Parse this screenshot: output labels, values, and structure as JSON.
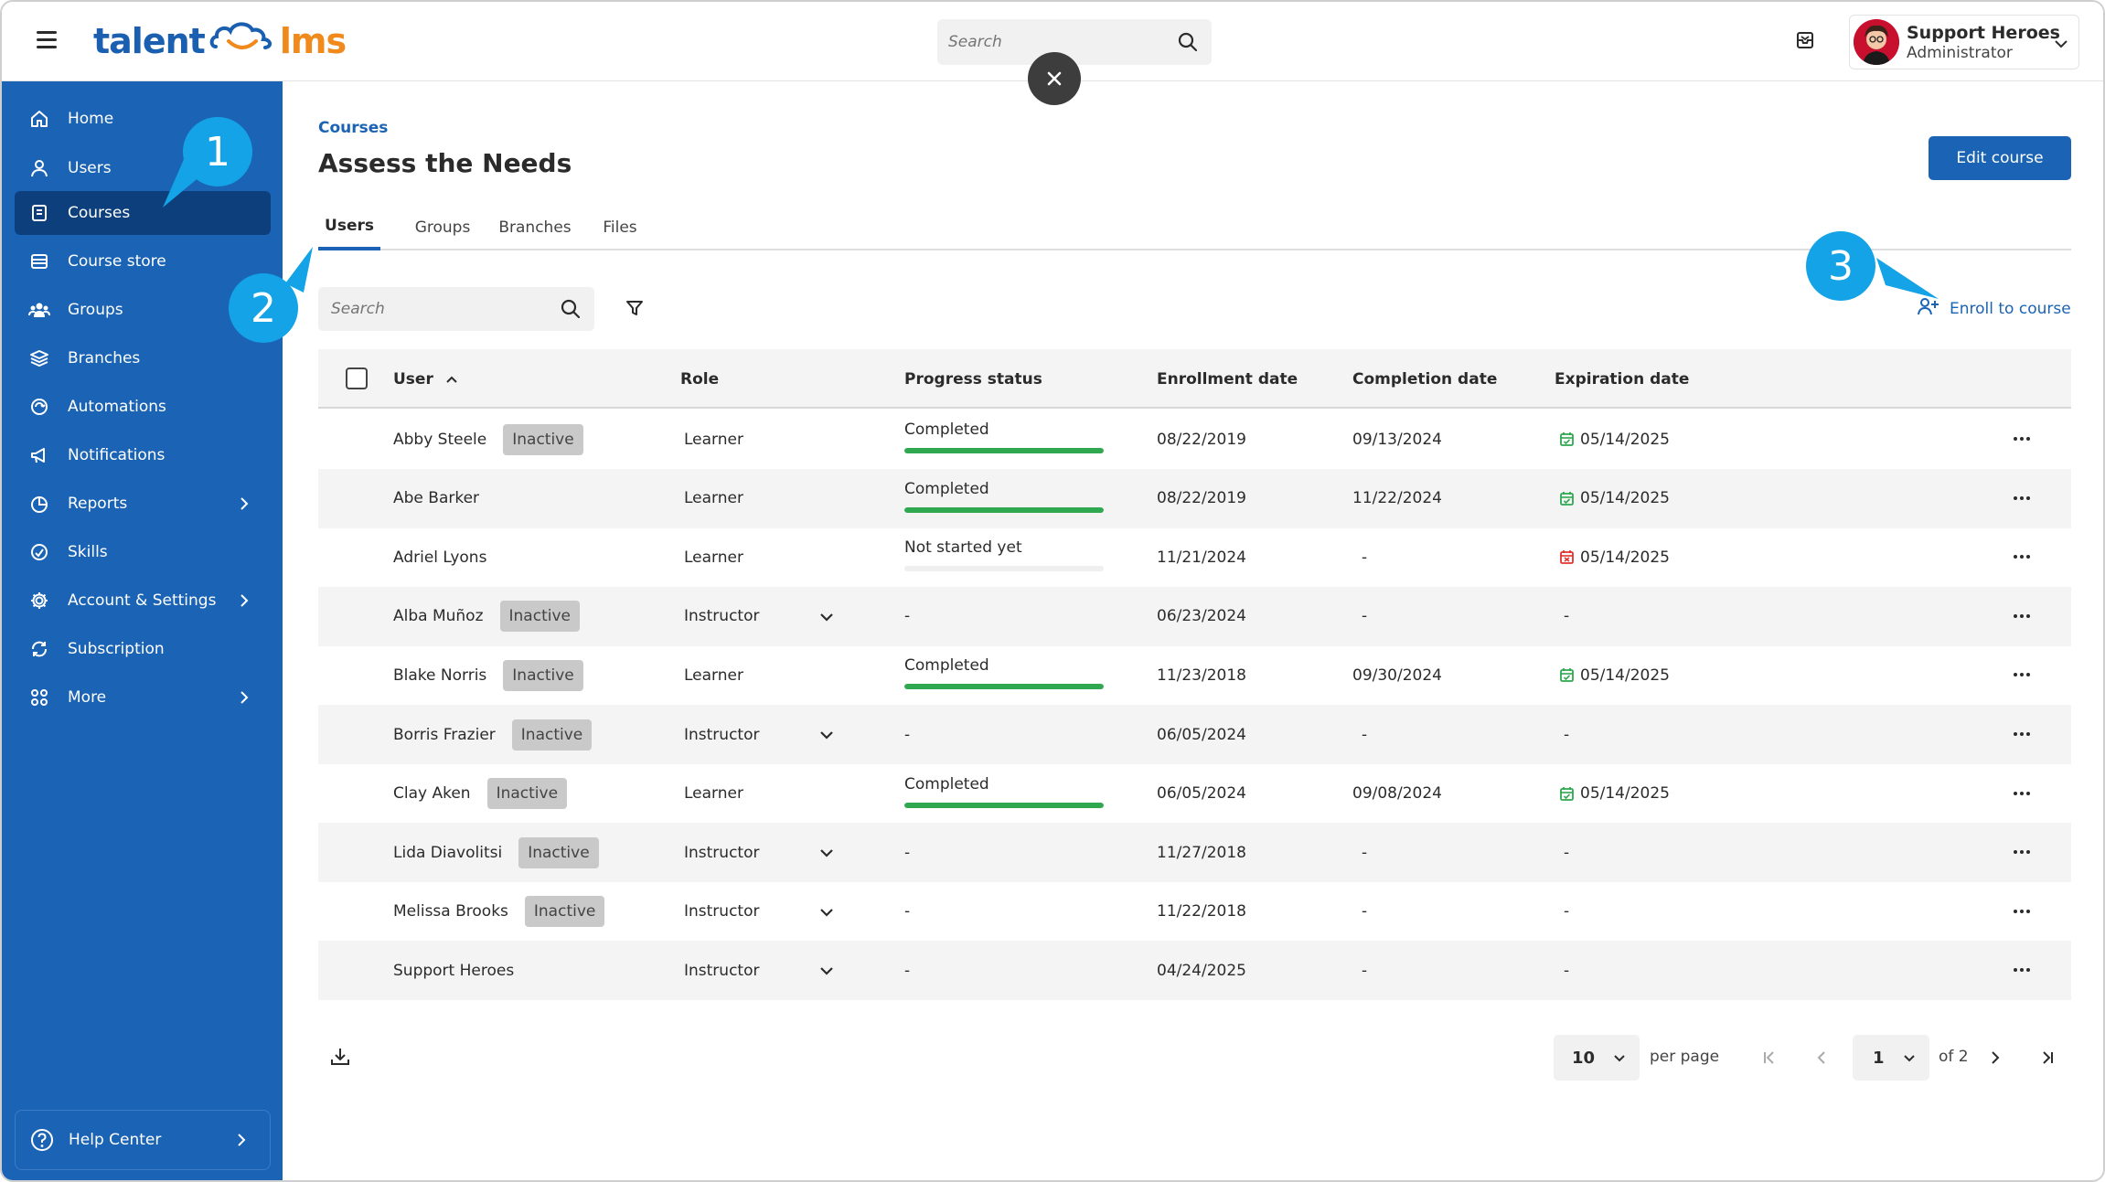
{
  "app": {
    "logo_left": "talent",
    "logo_right": "lms"
  },
  "top_search": {
    "placeholder": "Search"
  },
  "user": {
    "name": "Support Heroes",
    "role": "Administrator"
  },
  "colors": {
    "primary": "#1b63b4",
    "nav_active": "#0d3f7d",
    "callout": "#13a3e6",
    "progress": "#2fa84f",
    "badge": "#c9c9c9"
  },
  "sidebar": {
    "items": [
      {
        "label": "Home",
        "icon": "home-icon"
      },
      {
        "label": "Users",
        "icon": "user-icon"
      },
      {
        "label": "Courses",
        "icon": "book-icon",
        "active": true
      },
      {
        "label": "Course store",
        "icon": "store-icon"
      },
      {
        "label": "Groups",
        "icon": "groups-icon"
      },
      {
        "label": "Branches",
        "icon": "layers-icon"
      },
      {
        "label": "Automations",
        "icon": "automation-icon"
      },
      {
        "label": "Notifications",
        "icon": "megaphone-icon"
      },
      {
        "label": "Reports",
        "icon": "pie-chart-icon",
        "expandable": true
      },
      {
        "label": "Skills",
        "icon": "skills-icon"
      },
      {
        "label": "Account & Settings",
        "icon": "gear-icon",
        "expandable": true
      },
      {
        "label": "Subscription",
        "icon": "subscription-icon"
      },
      {
        "label": "More",
        "icon": "grid-icon",
        "expandable": true
      }
    ],
    "help": {
      "label": "Help Center",
      "icon": "question-icon"
    }
  },
  "callouts": [
    "1",
    "2",
    "3"
  ],
  "breadcrumb": "Courses",
  "page_title": "Assess the Needs",
  "edit_button": "Edit course",
  "tabs": [
    "Users",
    "Groups",
    "Branches",
    "Files"
  ],
  "table_search": {
    "placeholder": "Search"
  },
  "enroll_label": "Enroll to course",
  "table": {
    "headers": {
      "user": "User",
      "role": "Role",
      "progress": "Progress status",
      "enrollment": "Enrollment date",
      "completion": "Completion date",
      "expiration": "Expiration date"
    },
    "rows": [
      {
        "user": "Abby Steele",
        "badge": "Inactive",
        "role": "Learner",
        "progress": "Completed",
        "progress_value": 1.0,
        "enrollment": "08/22/2019",
        "completion": "09/13/2024",
        "expiration": "05/14/2025",
        "expiration_status": "ok"
      },
      {
        "user": "Abe Barker",
        "badge": "",
        "role": "Learner",
        "progress": "Completed",
        "progress_value": 1.0,
        "enrollment": "08/22/2019",
        "completion": "11/22/2024",
        "expiration": "05/14/2025",
        "expiration_status": "ok"
      },
      {
        "user": "Adriel Lyons",
        "badge": "",
        "role": "Learner",
        "progress": "Not started yet",
        "progress_value": 0.0,
        "enrollment": "11/21/2024",
        "completion": "-",
        "expiration": "05/14/2025",
        "expiration_status": "expired"
      },
      {
        "user": "Alba Muñoz",
        "badge": "Inactive",
        "role": "Instructor",
        "progress": "-",
        "enrollment": "06/23/2024",
        "completion": "-",
        "expiration": "-"
      },
      {
        "user": "Blake Norris",
        "badge": "Inactive",
        "role": "Learner",
        "progress": "Completed",
        "progress_value": 1.0,
        "enrollment": "11/23/2018",
        "completion": "09/30/2024",
        "expiration": "05/14/2025",
        "expiration_status": "ok"
      },
      {
        "user": "Borris Frazier",
        "badge": "Inactive",
        "role": "Instructor",
        "progress": "-",
        "enrollment": "06/05/2024",
        "completion": "-",
        "expiration": "-"
      },
      {
        "user": "Clay Aken",
        "badge": "Inactive",
        "role": "Learner",
        "progress": "Completed",
        "progress_value": 1.0,
        "enrollment": "06/05/2024",
        "completion": "09/08/2024",
        "expiration": "05/14/2025",
        "expiration_status": "ok"
      },
      {
        "user": "Lida Diavolitsi",
        "badge": "Inactive",
        "role": "Instructor",
        "progress": "-",
        "enrollment": "11/27/2018",
        "completion": "-",
        "expiration": "-"
      },
      {
        "user": "Melissa Brooks",
        "badge": "Inactive",
        "role": "Instructor",
        "progress": "-",
        "enrollment": "11/22/2018",
        "completion": "-",
        "expiration": "-"
      },
      {
        "user": "Support Heroes",
        "badge": "",
        "role": "Instructor",
        "progress": "-",
        "enrollment": "04/24/2025",
        "completion": "-",
        "expiration": "-"
      }
    ]
  },
  "pagination": {
    "per_page": "10",
    "per_page_label": "per page",
    "page": "1",
    "of_pages": "of 2"
  }
}
